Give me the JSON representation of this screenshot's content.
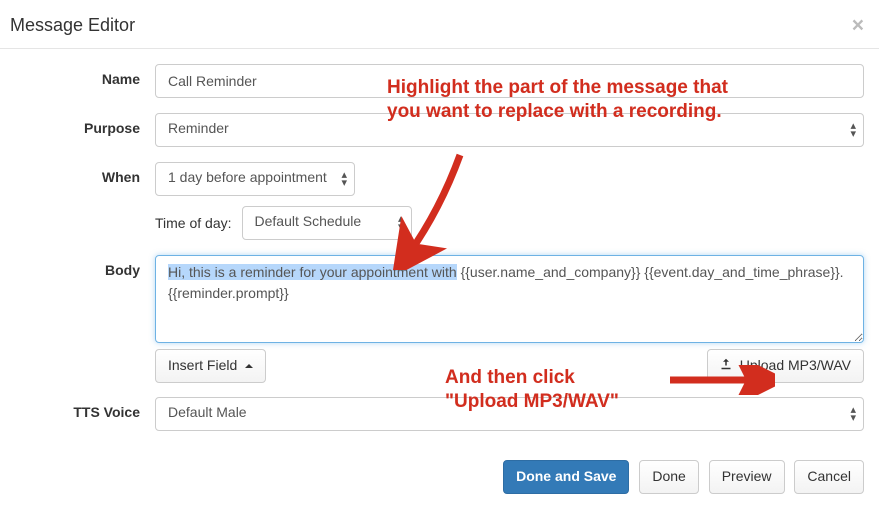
{
  "header": {
    "title": "Message Editor"
  },
  "form": {
    "name": {
      "label": "Name",
      "value": "Call Reminder"
    },
    "purpose": {
      "label": "Purpose",
      "value": "Reminder"
    },
    "when": {
      "label": "When",
      "value": "1 day before appointment",
      "time_label": "Time of day:",
      "time_value": "Default Schedule"
    },
    "body": {
      "label": "Body",
      "highlighted": "Hi, this is a reminder for your appointment with",
      "rest_line1": " {{user.name_and_company}} {{event.day_and_time_phrase}}.",
      "rest_line2": "{{reminder.prompt}}",
      "insert_field_label": "Insert Field",
      "upload_label": "Upload MP3/WAV"
    },
    "tts": {
      "label": "TTS Voice",
      "value": "Default Male"
    }
  },
  "footer": {
    "done_save": "Done and Save",
    "done": "Done",
    "preview": "Preview",
    "cancel": "Cancel"
  },
  "annotations": {
    "line1": "Highlight the part of the message that you want to replace with a recording.",
    "line2a": "And then click",
    "line2b": "\"Upload MP3/WAV\""
  },
  "colors": {
    "annotation": "#d22d1e",
    "primary": "#337ab7"
  }
}
